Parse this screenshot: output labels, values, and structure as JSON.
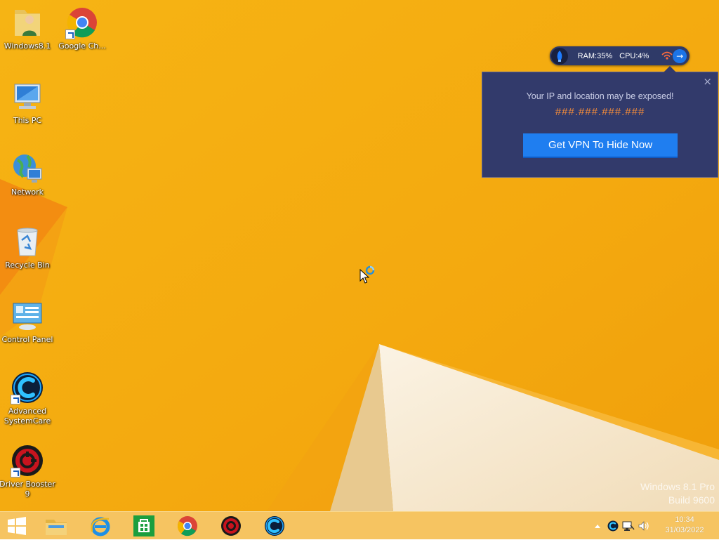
{
  "desktop_icons": [
    {
      "label": "Windows8.1"
    },
    {
      "label": "Google Ch..."
    },
    {
      "label": "This PC"
    },
    {
      "label": "Network"
    },
    {
      "label": "Recycle Bin"
    },
    {
      "label": "Control Panel"
    },
    {
      "label": "Advanced\nSystemCare"
    },
    {
      "label": "Driver Booster\n9"
    }
  ],
  "monitor": {
    "ram": "RAM:35%",
    "cpu": "CPU:4%"
  },
  "vpn_popup": {
    "message": "Your IP and location may be exposed!",
    "ip": "###.###.###.###",
    "button_label": "Get VPN To Hide Now",
    "close": "×"
  },
  "watermark": {
    "line1": "Windows 8.1 Pro",
    "line2": "Build 9600"
  },
  "taskbar": {
    "apps": [
      "start-icon",
      "file-explorer-icon",
      "internet-explorer-icon",
      "store-icon",
      "chrome-icon",
      "driver-booster-icon",
      "advanced-systemcare-icon"
    ]
  },
  "tray": {
    "time": "10:34",
    "date": "31/03/2022"
  },
  "colors": {
    "wallpaper": "#f5ad12",
    "popup_bg": "#323a6b",
    "cta": "#1f7ef0",
    "ip_text": "#f08a3a"
  }
}
